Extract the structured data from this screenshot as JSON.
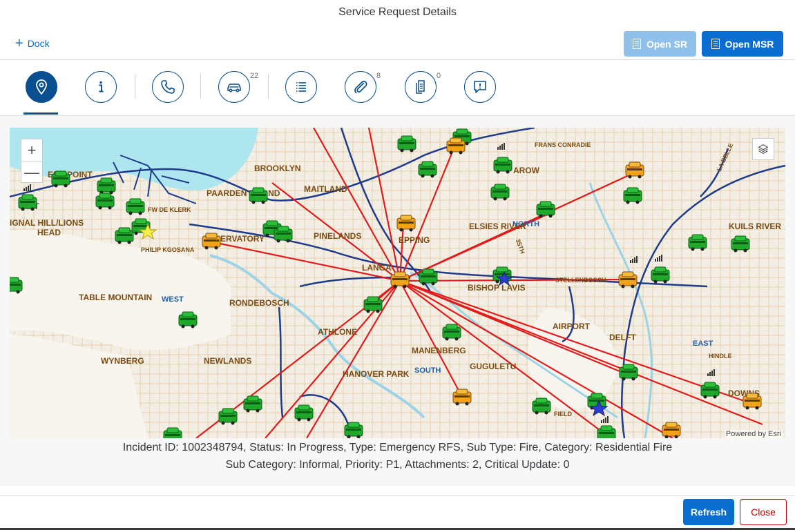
{
  "header": {
    "title": "Service Request Details",
    "dock_label": "Dock"
  },
  "actions": {
    "open_sr": "Open SR",
    "open_msr": "Open MSR"
  },
  "tabs": [
    {
      "name": "location",
      "icon": "map-pin-icon",
      "active": true,
      "badge": ""
    },
    {
      "name": "info",
      "icon": "info-icon",
      "active": false,
      "badge": ""
    },
    {
      "name": "calls",
      "icon": "phone-icon",
      "active": false,
      "badge": ""
    },
    {
      "name": "vehicles",
      "icon": "car-icon",
      "active": false,
      "badge": "22"
    },
    {
      "name": "log",
      "icon": "list-icon",
      "active": false,
      "badge": ""
    },
    {
      "name": "attachments",
      "icon": "paperclip-icon",
      "active": false,
      "badge": "8"
    },
    {
      "name": "documents",
      "icon": "documents-icon",
      "active": false,
      "badge": "0"
    },
    {
      "name": "critical-updates",
      "icon": "alert-message-icon",
      "active": false,
      "badge": ""
    }
  ],
  "map": {
    "attribution": "Powered by Esri",
    "zoom_in": "+",
    "zoom_out": "—",
    "place_labels": [
      "EEN POINT",
      "OINT",
      "IGNAL HILL/LIONS",
      "HEAD",
      "BROOKLYN",
      "PAARDEN EILAND",
      "MAITLAND",
      "FW DE KLERK",
      "PHILIP KGOSANA",
      "ERVATORY",
      "PINELANDS",
      "LANGA",
      "EPPING",
      "ELSIES RIVER",
      "NORTH",
      "BISHOP LAVIS",
      "STELLENBOSCH",
      "TABLE MOUNTAIN",
      "WEST",
      "RONDEBOSCH",
      "ATHLONE",
      "AIRPORT",
      "DELFT",
      "EAST",
      "HINDLE",
      "WYNBERG",
      "NEWLANDS",
      "MANENBERG",
      "GUGULETU",
      "HANOVER PARK",
      "SOUTH",
      "FRANS CONRADIE",
      "AROW",
      "KUILS RIVER",
      "LA BELLE",
      "FIELD",
      "35TH",
      "DOWNS"
    ],
    "colors": {
      "route": "#e11b1b",
      "water": "#aee6f0",
      "land": "#f3efe6",
      "roads": "#1e3a8a"
    }
  },
  "incident": {
    "line1": "Incident ID: 1002348794, Status: In Progress, Type: Emergency RFS, Sub Type: Fire, Category: Residential Fire",
    "line2": "Sub Category: Informal, Priority: P1, Attachments: 2, Critical Update: 0"
  },
  "footer": {
    "refresh": "Refresh",
    "close": "Close"
  }
}
